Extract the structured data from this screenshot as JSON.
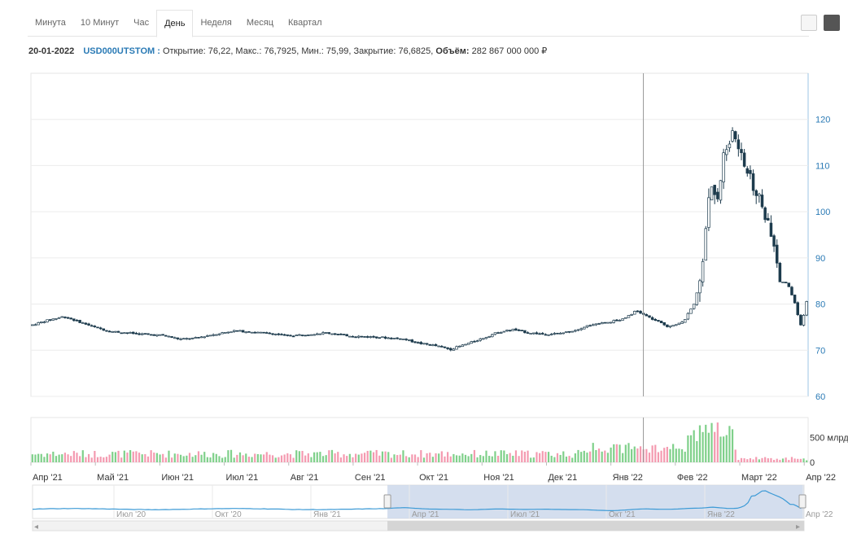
{
  "tabs": [
    {
      "label": "Минута",
      "active": false
    },
    {
      "label": "10 Минут",
      "active": false
    },
    {
      "label": "Час",
      "active": false
    },
    {
      "label": "День",
      "active": true
    },
    {
      "label": "Неделя",
      "active": false
    },
    {
      "label": "Месяц",
      "active": false
    },
    {
      "label": "Квартал",
      "active": false
    }
  ],
  "view_icons": [
    "line-chart-icon",
    "candlestick-chart-icon"
  ],
  "info": {
    "date": "20-01-2022",
    "ticker": "USD000UTSTOM :",
    "ohlc_text": "Открытие: 76,22, Макс.: 76,7925, Мин.: 75,99, Закрытие: 76,6825,",
    "volume_label": "Объём:",
    "volume_value": "282 867 000 000 ₽"
  },
  "colors": {
    "candle_up": "#ffffff",
    "candle_down": "#1d3b4d",
    "volume_up": "#7fd08a",
    "volume_down": "#f49ab0",
    "ytick": "#2a7ab5",
    "navigator_line": "#3c9ad6",
    "navigator_fill": "#c9d6ea"
  },
  "chart_data": {
    "type": "candlestick",
    "ylim": [
      60,
      130
    ],
    "yticks": [
      60,
      70,
      80,
      90,
      100,
      110,
      120
    ],
    "ytick_labels": [
      "60",
      "70",
      "80",
      "90",
      "100",
      "110",
      "120"
    ],
    "x_labels": [
      "Апр '21",
      "Май '21",
      "Июн '21",
      "Июл '21",
      "Авг '21",
      "Сен '21",
      "Окт '21",
      "Ноя '21",
      "Дек '21",
      "Янв '22",
      "Фев '22",
      "Март '22",
      "Апр '22"
    ],
    "highlighted": {
      "date": "20-01-2022",
      "open": 76.22,
      "high": 76.7925,
      "low": 75.99,
      "close": 76.6825
    },
    "close_path": [
      {
        "t": 0.0,
        "v": 75.5
      },
      {
        "t": 0.02,
        "v": 76.5
      },
      {
        "t": 0.04,
        "v": 77.3
      },
      {
        "t": 0.06,
        "v": 76.2
      },
      {
        "t": 0.08,
        "v": 75.0
      },
      {
        "t": 0.1,
        "v": 74.1
      },
      {
        "t": 0.12,
        "v": 73.8
      },
      {
        "t": 0.14,
        "v": 73.5
      },
      {
        "t": 0.17,
        "v": 73.2
      },
      {
        "t": 0.19,
        "v": 72.4
      },
      {
        "t": 0.21,
        "v": 72.6
      },
      {
        "t": 0.23,
        "v": 73.3
      },
      {
        "t": 0.26,
        "v": 74.2
      },
      {
        "t": 0.28,
        "v": 74.0
      },
      {
        "t": 0.31,
        "v": 73.6
      },
      {
        "t": 0.33,
        "v": 73.1
      },
      {
        "t": 0.36,
        "v": 73.5
      },
      {
        "t": 0.38,
        "v": 73.8
      },
      {
        "t": 0.4,
        "v": 73.3
      },
      {
        "t": 0.42,
        "v": 73.0
      },
      {
        "t": 0.45,
        "v": 72.8
      },
      {
        "t": 0.48,
        "v": 72.4
      },
      {
        "t": 0.5,
        "v": 71.5
      },
      {
        "t": 0.52,
        "v": 71.0
      },
      {
        "t": 0.54,
        "v": 70.2
      },
      {
        "t": 0.56,
        "v": 71.3
      },
      {
        "t": 0.58,
        "v": 72.5
      },
      {
        "t": 0.6,
        "v": 73.8
      },
      {
        "t": 0.62,
        "v": 74.5
      },
      {
        "t": 0.64,
        "v": 73.8
      },
      {
        "t": 0.66,
        "v": 73.5
      },
      {
        "t": 0.68,
        "v": 73.6
      },
      {
        "t": 0.7,
        "v": 74.3
      },
      {
        "t": 0.72,
        "v": 75.5
      },
      {
        "t": 0.74,
        "v": 76.0
      },
      {
        "t": 0.76,
        "v": 76.6
      },
      {
        "t": 0.78,
        "v": 78.5
      },
      {
        "t": 0.8,
        "v": 76.8
      },
      {
        "t": 0.82,
        "v": 75.2
      },
      {
        "t": 0.84,
        "v": 76.0
      },
      {
        "t": 0.855,
        "v": 80.0
      },
      {
        "t": 0.865,
        "v": 88.0
      },
      {
        "t": 0.875,
        "v": 106.0
      },
      {
        "t": 0.885,
        "v": 104.0
      },
      {
        "t": 0.895,
        "v": 114.0
      },
      {
        "t": 0.905,
        "v": 117.0
      },
      {
        "t": 0.915,
        "v": 112.0
      },
      {
        "t": 0.93,
        "v": 106.0
      },
      {
        "t": 0.945,
        "v": 100.0
      },
      {
        "t": 0.955,
        "v": 94.0
      },
      {
        "t": 0.965,
        "v": 85.0
      },
      {
        "t": 0.975,
        "v": 84.5
      },
      {
        "t": 0.985,
        "v": 80.0
      },
      {
        "t": 0.993,
        "v": 75.0
      },
      {
        "t": 1.0,
        "v": 80.5
      }
    ],
    "volume_panel": {
      "yticks": [
        0,
        500
      ],
      "ytick_labels": [
        "0",
        "500 млрд"
      ],
      "unit": "млрд",
      "ylim": [
        0,
        900
      ]
    },
    "navigator": {
      "x_labels": [
        "Июл '20",
        "Окт '20",
        "Янв '21",
        "Апр '21",
        "Июл '21",
        "Окт '21",
        "Янв '22",
        "Апр '22"
      ],
      "selected_range_fraction": [
        0.46,
        1.0
      ]
    }
  }
}
